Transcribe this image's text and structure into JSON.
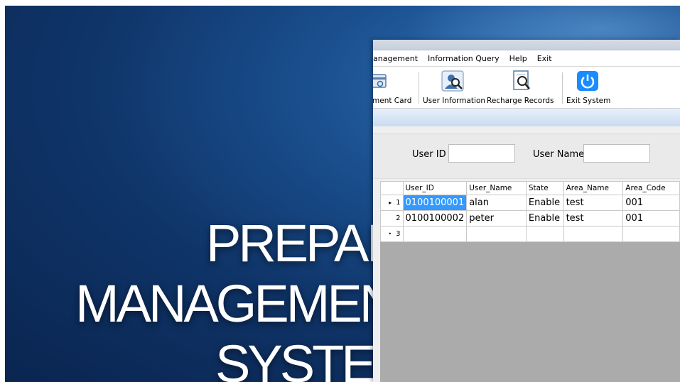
{
  "splash": {
    "line1": "PREPAID",
    "line2": "MANAGEMENT",
    "line3": "SYSTEM"
  },
  "menu": {
    "items": [
      "lanagement",
      "Information Query",
      "Help",
      "Exit"
    ]
  },
  "toolbar": {
    "buttons": [
      {
        "label": "ment Card",
        "icon": "card-icon"
      },
      {
        "label": "User Information",
        "icon": "user-search-icon"
      },
      {
        "label": "Recharge Records",
        "icon": "document-search-icon"
      },
      {
        "label": "Exit System",
        "icon": "power-icon"
      }
    ]
  },
  "search": {
    "user_id_label": "User ID",
    "user_id_value": "",
    "user_name_label": "User Name",
    "user_name_value": ""
  },
  "grid": {
    "columns": [
      "User_ID",
      "User_Name",
      "State",
      "Area_Name",
      "Area_Code"
    ],
    "rows": [
      {
        "num": "1",
        "marker": "▸",
        "cells": [
          "0100100001",
          "alan",
          "Enable",
          "test",
          "001"
        ]
      },
      {
        "num": "2",
        "marker": "",
        "cells": [
          "0100100002",
          "peter",
          "Enable",
          "test",
          "001"
        ]
      },
      {
        "num": "3",
        "marker": "•",
        "cells": [
          "",
          "",
          "",
          "",
          ""
        ]
      }
    ]
  },
  "colors": {
    "accent": "#3399ff",
    "splash_bg": "#0f3468",
    "power_icon": "#1a8cff"
  }
}
